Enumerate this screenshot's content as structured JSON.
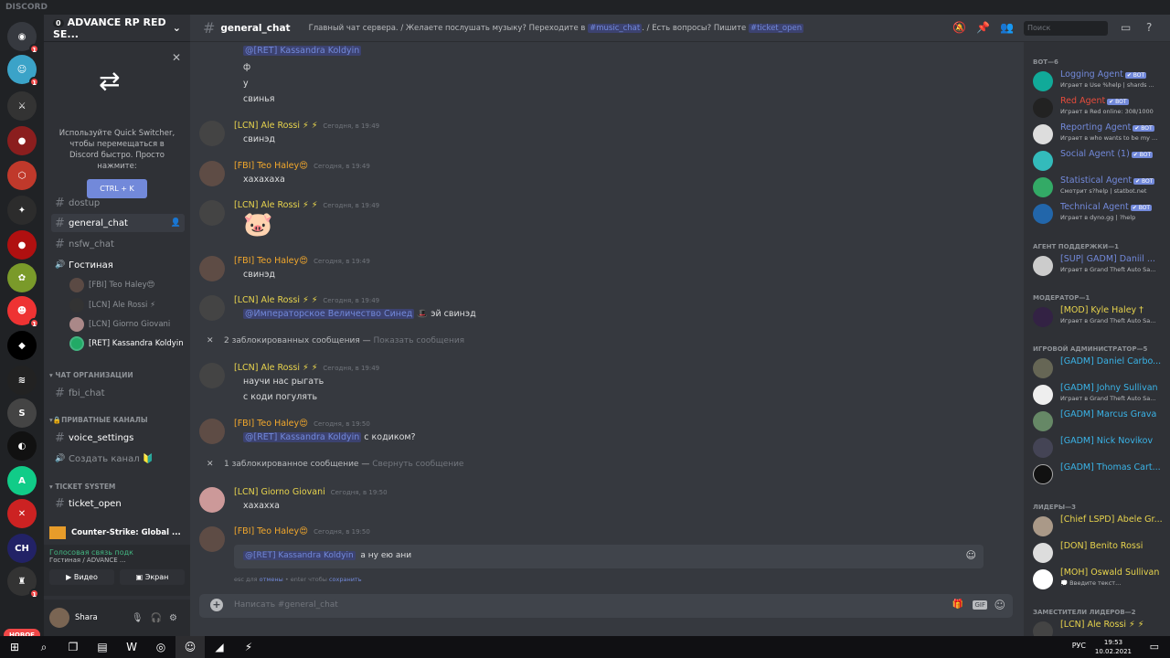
{
  "app": {
    "title": "DISCORD"
  },
  "guilds": {
    "new_label": "НОВОЕ",
    "badges": [
      "1",
      "1",
      "1",
      "1"
    ]
  },
  "server": {
    "name": "ADVANCE RP RED SE...",
    "badge": "0"
  },
  "quick_switcher": {
    "text": "Используйте Quick Switcher, чтобы перемещаться в Discord быстро. Просто нажмите:",
    "shortcut": "CTRL + K"
  },
  "channels": {
    "items": [
      "dostup",
      "general_chat",
      "nsfw_chat",
      "Гостиная"
    ],
    "voice_users": [
      "[FBI] Teo Haley😍",
      "[LCN] Ale Rossi ⚡",
      "[LCN] Giorno Giovani",
      "[RET] Kassandra Koldyin"
    ],
    "cat_org": "ЧАТ ОРГАНИЗАЦИИ",
    "fbi_chat": "fbi_chat",
    "cat_private": "ПРИВАТНЫЕ КАНАЛЫ",
    "voice_settings": "voice_settings",
    "create_channel": "Создать канал 🔰",
    "cat_ticket": "TICKET SYSTEM",
    "ticket_open": "ticket_open"
  },
  "game": {
    "name": "Counter-Strike: Global ..."
  },
  "voice_panel": {
    "status": "Голосовая связь подк",
    "location": "Гостиная / ADVANCE ...",
    "video": "Видео",
    "screen": "Экран"
  },
  "user": {
    "name": "Shara"
  },
  "topbar": {
    "channel": "general_chat",
    "topic_a": "Главный чат сервера. / Желаете послушать музыку? Переходите в",
    "topic_link1": "#music_chat",
    "topic_b": ". / Есть вопросы? Пишите",
    "topic_link2": "#ticket_open",
    "search_placeholder": "Поиск"
  },
  "messages": {
    "m0_mention": "@[RET] Kassandra Koldyin",
    "m0_l1": "ф",
    "m0_l2": "у",
    "m0_l3": "свинья",
    "m1_name": "[LCN] Ale Rossi ⚡ ⚡",
    "m1_time": "Сегодня, в 19:49",
    "m1_text": "свинэд",
    "m2_name": "[FBI] Teo Haley😍",
    "m2_time": "Сегодня, в 19:49",
    "m2_text": "хахахаха",
    "m3_name": "[LCN] Ale Rossi ⚡ ⚡",
    "m3_time": "Сегодня, в 19:49",
    "m3_text": "🐷",
    "m4_name": "[FBI] Teo Haley😍",
    "m4_time": "Сегодня, в 19:49",
    "m4_text": "свинэд",
    "m5_name": "[LCN] Ale Rossi ⚡ ⚡",
    "m5_time": "Сегодня, в 19:49",
    "m5_mention": "@Императорское Величество Синед",
    "m5_text": "🎩 эй свинэд",
    "blocked1": "2 заблокированных сообщения —",
    "blocked1_link": "Показать сообщения",
    "m6_name": "[LCN] Ale Rossi ⚡ ⚡",
    "m6_time": "Сегодня, в 19:49",
    "m6_l1": "научи нас рыгать",
    "m6_l2": "с коди погулять",
    "m7_name": "[FBI] Teo Haley😍",
    "m7_time": "Сегодня, в 19:50",
    "m7_mention": "@[RET] Kassandra Koldyin",
    "m7_text": "с кодиком?",
    "blocked2": "1 заблокированное сообщение —",
    "blocked2_link": "Свернуть сообщение",
    "m8_name": "[LCN] Giorno Giovani",
    "m8_time": "Сегодня, в 19:50",
    "m8_text": "хахахха",
    "m9_name": "[FBI] Teo Haley😍",
    "m9_time": "Сегодня, в 19:50"
  },
  "edit": {
    "mention": "@[RET] Kassandra Koldyin",
    "text": "а ну ею ани",
    "hint_a": "esc для",
    "hint_cancel": "отмены",
    "hint_b": "• enter чтобы",
    "hint_save": "сохранить"
  },
  "composer": {
    "placeholder": "Написать #general_chat",
    "gif": "GIF"
  },
  "members": {
    "cat_bot": "BOT—6",
    "bots": [
      {
        "name": "Logging Agent",
        "status": "Играет в Use %help | shards ..."
      },
      {
        "name": "Red Agent",
        "status": "Играет в Red online: 308/1000"
      },
      {
        "name": "Reporting Agent",
        "status": "Играет в who wants to be my ..."
      },
      {
        "name": "Social Agent (1)",
        "status": ""
      },
      {
        "name": "Statistical Agent",
        "status": "Смотрит s?help | statbot.net"
      },
      {
        "name": "Technical Agent",
        "status": "Играет в dyno.gg | ?help"
      }
    ],
    "bot_tag": "✔ BOT",
    "cat_support": "АГЕНТ ПОДДЕРЖКИ—1",
    "support": {
      "name": "[SUP| GADM] Daniil ...",
      "status": "Играет в Grand Theft Auto Sa..."
    },
    "cat_mod": "МОДЕРАТОР—1",
    "mod": {
      "name": "[MOD] Kyle Haley †",
      "status": "Играет в Grand Theft Auto Sa..."
    },
    "cat_gadm": "ИГРОВОЙ АДМИНИСТРАТОР—5",
    "gadm": [
      {
        "name": "[GADM] Daniel Carbo...",
        "status": ""
      },
      {
        "name": "[GADM] Johny Sullivan",
        "status": "Играет в Grand Theft Auto Sa..."
      },
      {
        "name": "[GADM] Marcus Grava",
        "status": ""
      },
      {
        "name": "[GADM] Nick Novikov",
        "status": ""
      },
      {
        "name": "[GADM] Thomas Cart...",
        "status": ""
      }
    ],
    "cat_leaders": "ЛИДЕРЫ—3",
    "leaders": [
      {
        "name": "[Chief LSPD] Abele Gr...",
        "status": ""
      },
      {
        "name": "[DON] Benito Rossi",
        "status": ""
      },
      {
        "name": "[MOH] Oswald Sullivan",
        "status": "💭 Введите текст..."
      }
    ],
    "cat_deputy": "ЗАМЕСТИТЕЛИ ЛИДЕРОВ—2",
    "deputy": {
      "name": "[LCN] Ale Rossi ⚡ ⚡",
      "status": ""
    }
  },
  "taskbar": {
    "lang": "РУС",
    "time": "19:53",
    "date": "10.02.2021"
  },
  "colors": {
    "accent": "#7289da",
    "bg": "#36393f",
    "sidebar": "#2f3136",
    "green": "#43b581",
    "red": "#f04747"
  }
}
